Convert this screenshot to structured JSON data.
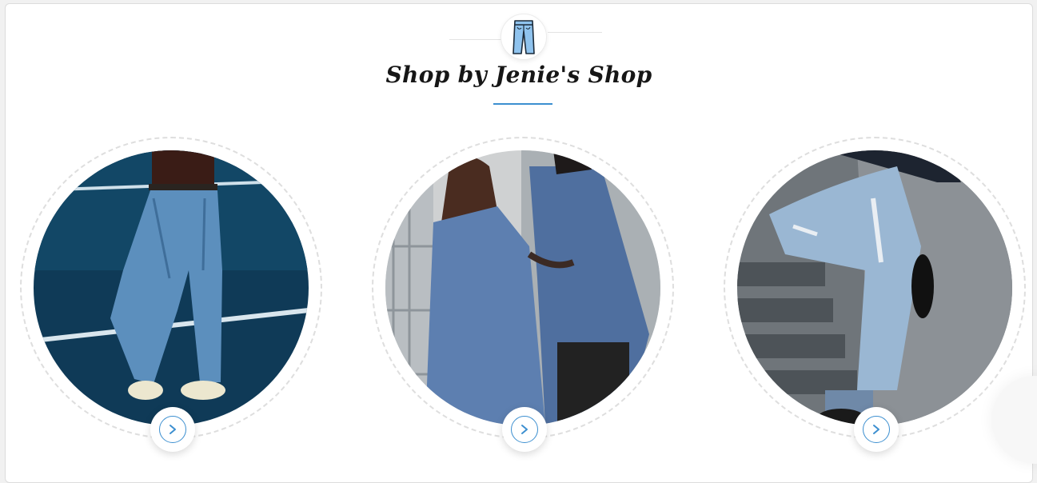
{
  "section": {
    "title": "Shop by Jenie's Shop",
    "logo_icon": "jeans-icon",
    "accent_color": "#3c8fd0"
  },
  "categories": [
    {
      "image": "woman-in-jeans-against-blue-court",
      "action_icon": "chevron-right-icon"
    },
    {
      "image": "couple-in-denim-jackets",
      "action_icon": "chevron-right-icon"
    },
    {
      "image": "man-in-ripped-jeans-on-stairs",
      "action_icon": "chevron-right-icon"
    }
  ]
}
